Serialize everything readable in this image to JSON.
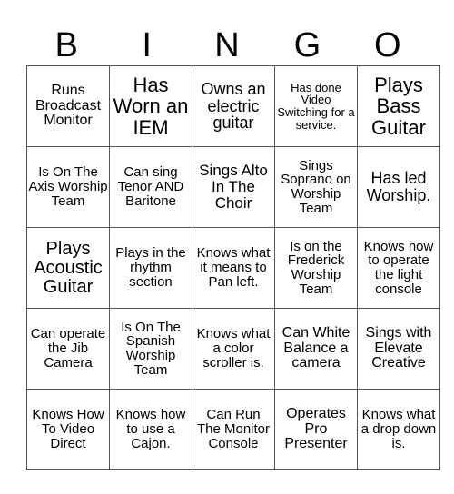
{
  "header": {
    "letters": [
      "B",
      "I",
      "N",
      "G",
      "O"
    ]
  },
  "grid": {
    "rows": [
      [
        "Runs Broadcast Monitor",
        "Has Worn an IEM",
        "Owns an electric guitar",
        "Has done Video Switching for a service.",
        "Plays Bass Guitar"
      ],
      [
        "Is On The Axis Worship Team",
        "Can sing Tenor AND Baritone",
        "Sings Alto In The Choir",
        "Sings Soprano on Worship Team",
        "Has led Worship."
      ],
      [
        "Plays Acoustic Guitar",
        "Plays in the rhythm section",
        "Knows what it means to Pan left.",
        "Is on the Frederick Worship Team",
        "Knows how to operate the light console"
      ],
      [
        "Can operate the Jib Camera",
        "Is On The Spanish Worship Team",
        "Knows what a color scroller is.",
        "Can White Balance a camera",
        "Sings with Elevate Creative"
      ],
      [
        "Knows How To Video Direct",
        "Knows how to use a Cajon.",
        "Can Run The Monitor Console",
        "Operates Pro Presenter",
        "Knows what a drop down is."
      ]
    ]
  }
}
